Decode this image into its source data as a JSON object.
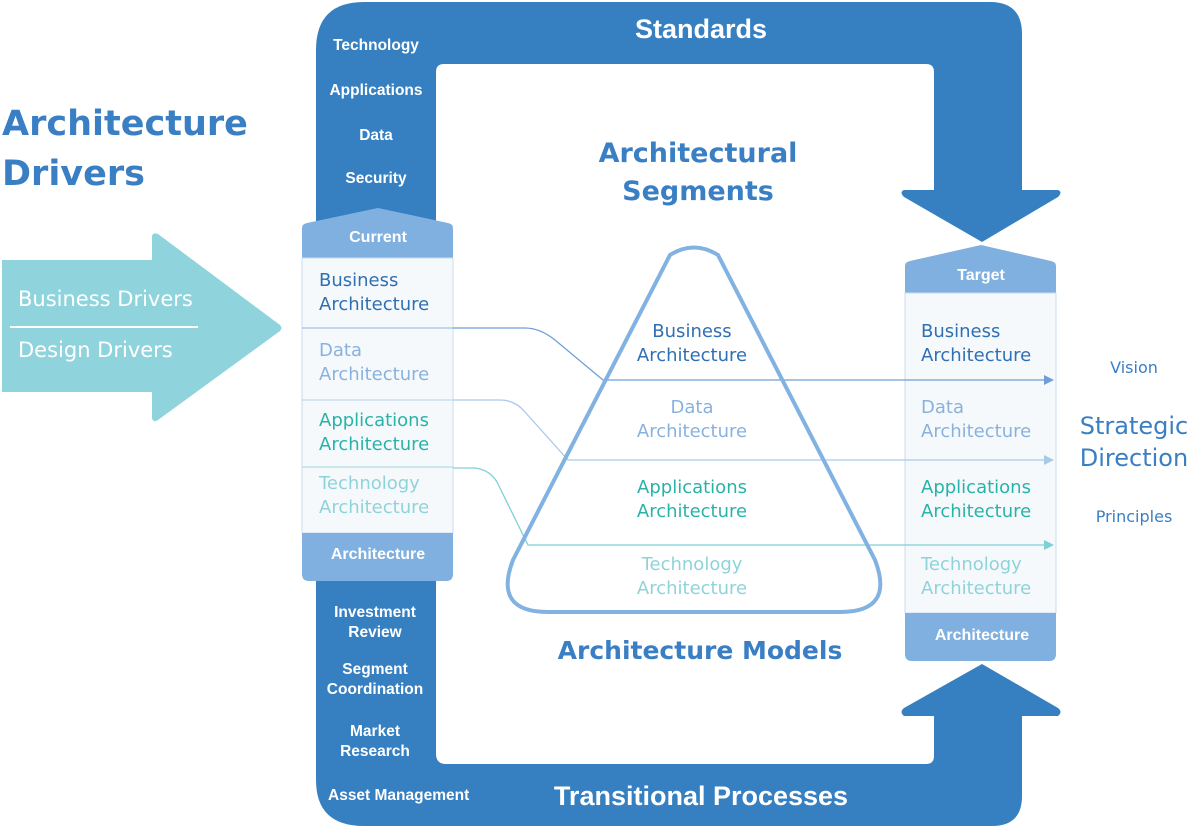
{
  "colors": {
    "frame_blue": "#3680c2",
    "column_header_blue": "#7fb0e0",
    "column_body": "#f6f9fc",
    "driver_arrow": "#8fd4dc",
    "pyramid_stroke": "#82b2e1",
    "business": "#2f6fb3",
    "data": "#88b2de",
    "applications": "#29b3a8",
    "technology": "#8fd3da"
  },
  "drivers": {
    "title_line1": "Architecture",
    "title_line2": "Drivers",
    "items": [
      "Business Drivers",
      "Design Drivers"
    ]
  },
  "frame": {
    "top_title": "Standards",
    "bottom_title": "Transitional Processes",
    "top_items": [
      "Technology",
      "Applications",
      "Data",
      "Security"
    ],
    "bottom_items": [
      {
        "line1": "Investment",
        "line2": "Review"
      },
      {
        "line1": "Segment",
        "line2": "Coordination"
      },
      {
        "line1": "Market",
        "line2": "Research"
      },
      {
        "line1": "Asset Management",
        "line2": ""
      }
    ]
  },
  "current_column": {
    "header": "Current",
    "footer": "Architecture",
    "layers": [
      {
        "line1": "Business",
        "line2": "Architecture",
        "tone": "business"
      },
      {
        "line1": "Data",
        "line2": "Architecture",
        "tone": "data"
      },
      {
        "line1": "Applications",
        "line2": "Architecture",
        "tone": "applications"
      },
      {
        "line1": "Technology",
        "line2": "Architecture",
        "tone": "technology"
      }
    ]
  },
  "target_column": {
    "header": "Target",
    "footer": "Architecture",
    "layers": [
      {
        "line1": "Business",
        "line2": "Architecture",
        "tone": "business"
      },
      {
        "line1": "Data",
        "line2": "Architecture",
        "tone": "data"
      },
      {
        "line1": "Applications",
        "line2": "Architecture",
        "tone": "applications"
      },
      {
        "line1": "Technology",
        "line2": "Architecture",
        "tone": "technology"
      }
    ]
  },
  "center": {
    "segments_line1": "Architectural",
    "segments_line2": "Segments",
    "models_title": "Architecture Models",
    "pyramid_layers": [
      {
        "line1": "Business",
        "line2": "Architecture",
        "tone": "business"
      },
      {
        "line1": "Data",
        "line2": "Architecture",
        "tone": "data"
      },
      {
        "line1": "Applications",
        "line2": "Architecture",
        "tone": "applications"
      },
      {
        "line1": "Technology",
        "line2": "Architecture",
        "tone": "technology"
      }
    ]
  },
  "strategic": {
    "vision": "Vision",
    "title_line1": "Strategic",
    "title_line2": "Direction",
    "principles": "Principles"
  }
}
